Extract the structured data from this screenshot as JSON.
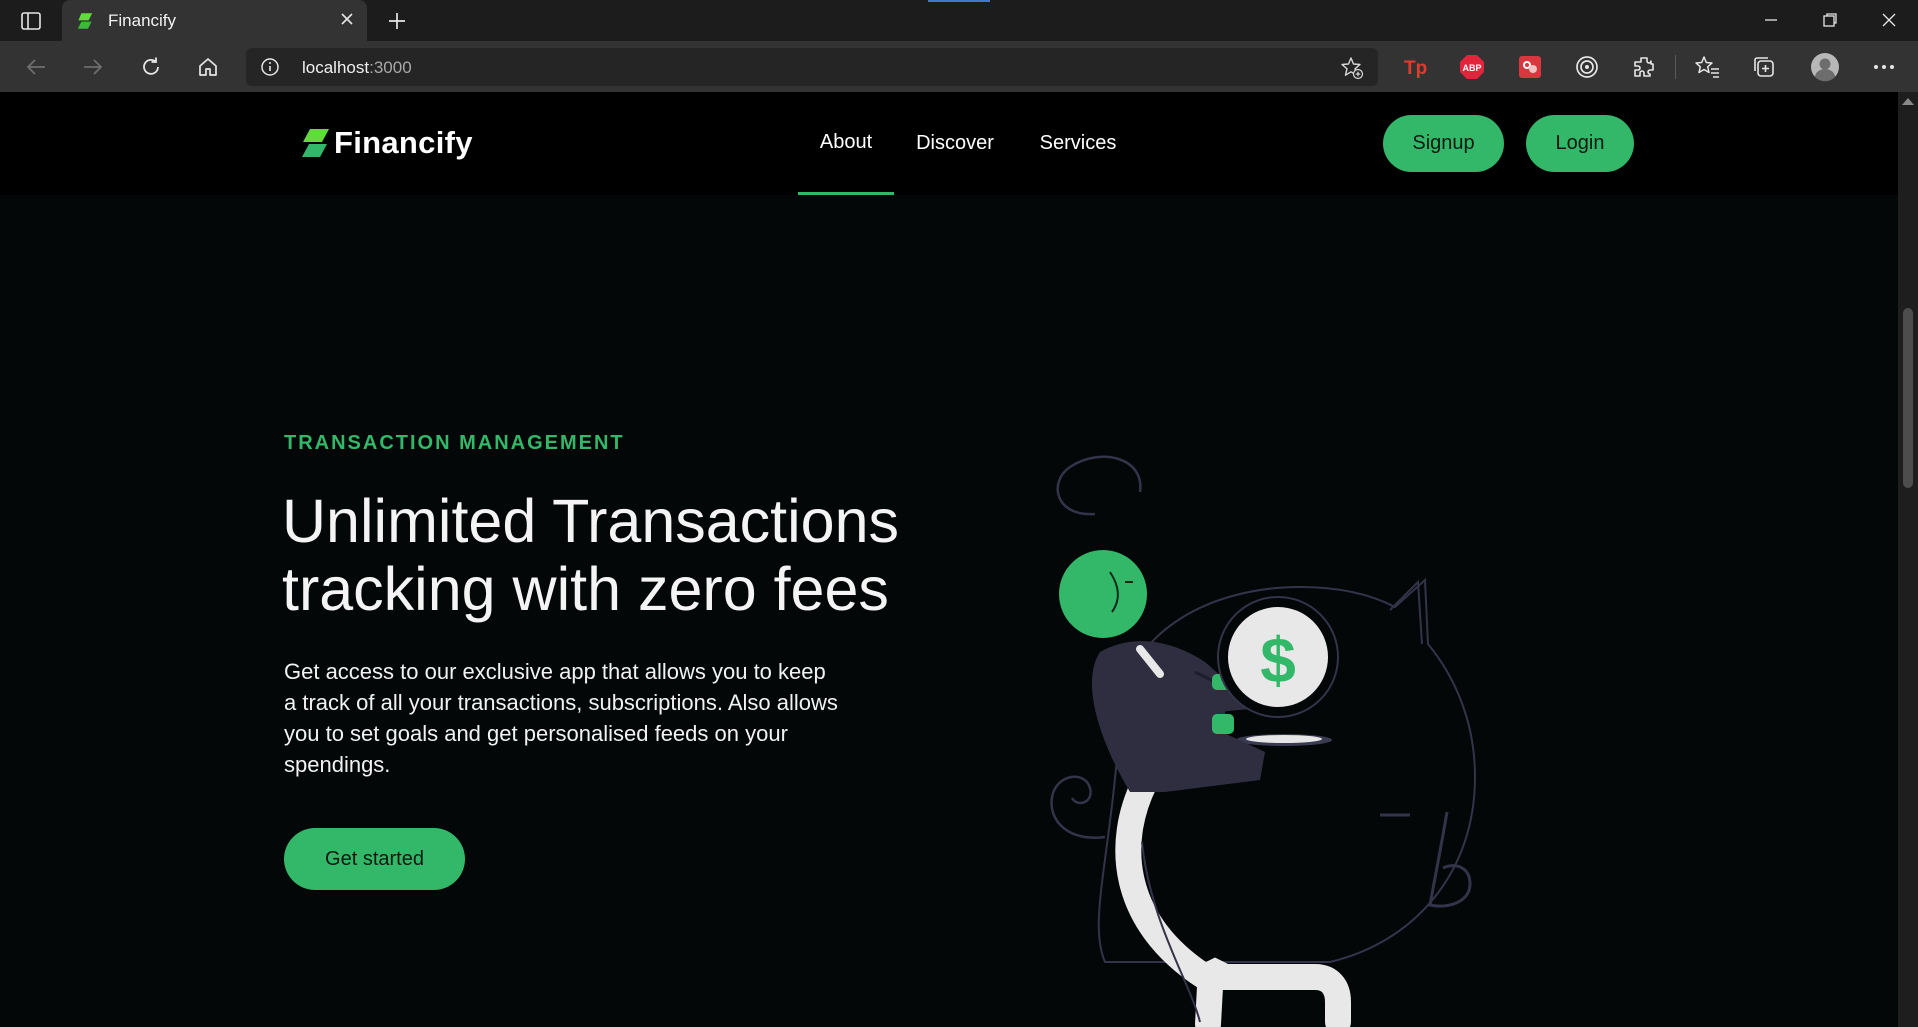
{
  "browser": {
    "tab_title": "Financify",
    "url_host": "localhost",
    "url_port": ":3000"
  },
  "site": {
    "brand": "Financify",
    "nav": [
      {
        "label": "About",
        "active": true
      },
      {
        "label": "Discover",
        "active": false
      },
      {
        "label": "Services",
        "active": false
      }
    ],
    "signup_label": "Signup",
    "login_label": "Login"
  },
  "hero": {
    "eyebrow": "TRANSACTION MANAGEMENT",
    "headline_line1": "Unlimited Transactions",
    "headline_line2": "tracking with zero fees",
    "description": "Get access to our exclusive app that allows you to keep a track of all your transactions, subscriptions. Also allows you to set goals and get personalised feeds on your spendings.",
    "cta_label": "Get started",
    "coin_symbol": "$"
  },
  "colors": {
    "accent": "#33b86a",
    "page_bg": "#030708",
    "nav_bg": "#000000",
    "chrome_bg": "#333333"
  },
  "icons": [
    "tab-actions-icon",
    "financify-favicon",
    "close-icon",
    "plus-icon",
    "back-icon",
    "forward-icon",
    "refresh-icon",
    "home-icon",
    "info-icon",
    "add-favorite-icon",
    "textpad-extension-icon",
    "adblock-plus-icon",
    "red-extension-icon",
    "target-extension-icon",
    "extensions-icon",
    "favorites-icon",
    "collections-icon",
    "profile-icon",
    "more-icon",
    "minimize-icon",
    "restore-icon",
    "window-close-icon",
    "scroll-up-arrow"
  ]
}
